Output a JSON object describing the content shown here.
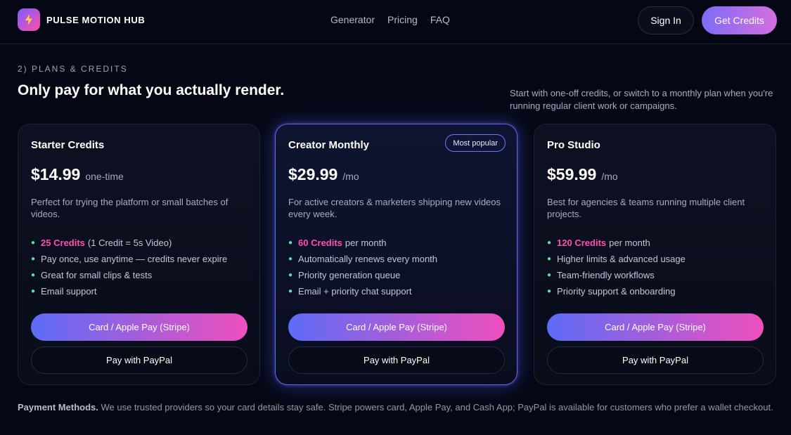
{
  "header": {
    "brand": "PULSE MOTION HUB",
    "logo_icon": "lightning-bolt-icon",
    "nav": [
      "Generator",
      "Pricing",
      "FAQ"
    ],
    "sign_in": "Sign In",
    "get_credits": "Get Credits"
  },
  "section": {
    "eyebrow": "2) PLANS & CREDITS",
    "headline": "Only pay for what you actually render.",
    "subhead": "Start with one-off credits, or switch to a monthly plan when you're running regular client work or campaigns."
  },
  "plans": [
    {
      "title": "Starter Credits",
      "price": "$14.99",
      "period": "one-time",
      "description": "Perfect for trying the platform or small batches of videos.",
      "features": [
        {
          "highlight": "25 Credits",
          "text": "(1 Credit = 5s Video)"
        },
        {
          "highlight": "",
          "text": "Pay once, use anytime — credits never expire"
        },
        {
          "highlight": "",
          "text": "Great for small clips & tests"
        },
        {
          "highlight": "",
          "text": "Email support"
        }
      ],
      "stripe_label": "Card / Apple Pay (Stripe)",
      "paypal_label": "Pay with PayPal"
    },
    {
      "title": "Creator Monthly",
      "badge": "Most popular",
      "price": "$29.99",
      "period": "/mo",
      "description": "For active creators & marketers shipping new videos every week.",
      "features": [
        {
          "highlight": "60 Credits",
          "text": "per month"
        },
        {
          "highlight": "",
          "text": "Automatically renews every month"
        },
        {
          "highlight": "",
          "text": "Priority generation queue"
        },
        {
          "highlight": "",
          "text": "Email + priority chat support"
        }
      ],
      "stripe_label": "Card / Apple Pay (Stripe)",
      "paypal_label": "Pay with PayPal"
    },
    {
      "title": "Pro Studio",
      "price": "$59.99",
      "period": "/mo",
      "description": "Best for agencies & teams running multiple client projects.",
      "features": [
        {
          "highlight": "120 Credits",
          "text": "per month"
        },
        {
          "highlight": "",
          "text": "Higher limits & advanced usage"
        },
        {
          "highlight": "",
          "text": "Team-friendly workflows"
        },
        {
          "highlight": "",
          "text": "Priority support & onboarding"
        }
      ],
      "stripe_label": "Card / Apple Pay (Stripe)",
      "paypal_label": "Pay with PayPal"
    }
  ],
  "footer": {
    "label": "Payment Methods.",
    "text": "We use trusted providers so your card details stay safe. Stripe powers card, Apple Pay, and Cash App; PayPal is available for customers who prefer a wallet checkout."
  },
  "colors": {
    "background": "#050814",
    "accent_gradient_start": "#5c6cf6",
    "accent_gradient_end": "#f04fbe",
    "highlight_pink": "#ff4fb4",
    "bullet_green": "#59e2a7",
    "featured_border": "#5f6cf5"
  }
}
